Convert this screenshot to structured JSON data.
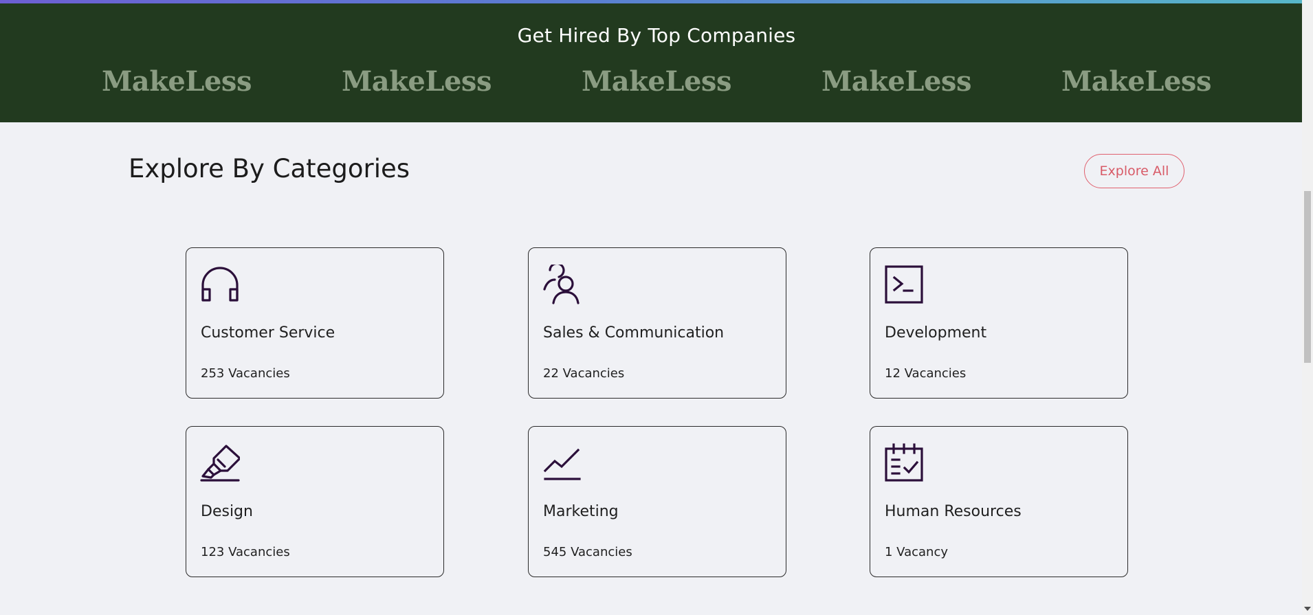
{
  "banner": {
    "title": "Get Hired By Top Companies",
    "logos": [
      "MakeLess",
      "MakeLess",
      "MakeLess",
      "MakeLess",
      "MakeLess"
    ]
  },
  "categories_section": {
    "title": "Explore By Categories",
    "explore_all_label": "Explore All",
    "cards": [
      {
        "name": "Customer Service",
        "count": "253 Vacancies",
        "icon": "headphones-icon"
      },
      {
        "name": "Sales & Communication",
        "count": "22 Vacancies",
        "icon": "users-icon"
      },
      {
        "name": "Development",
        "count": "12 Vacancies",
        "icon": "terminal-icon"
      },
      {
        "name": "Design",
        "count": "123 Vacancies",
        "icon": "highlighter-icon"
      },
      {
        "name": "Marketing",
        "count": "545 Vacancies",
        "icon": "trend-line-icon"
      },
      {
        "name": "Human Resources",
        "count": "1 Vacancy",
        "icon": "calendar-check-icon"
      }
    ]
  },
  "colors": {
    "banner_bg": "#223a1f",
    "logo_text": "#8a9c82",
    "accent": "#d85a67",
    "icon_stroke": "#2b0f3a",
    "page_bg": "#f0f1f5"
  }
}
